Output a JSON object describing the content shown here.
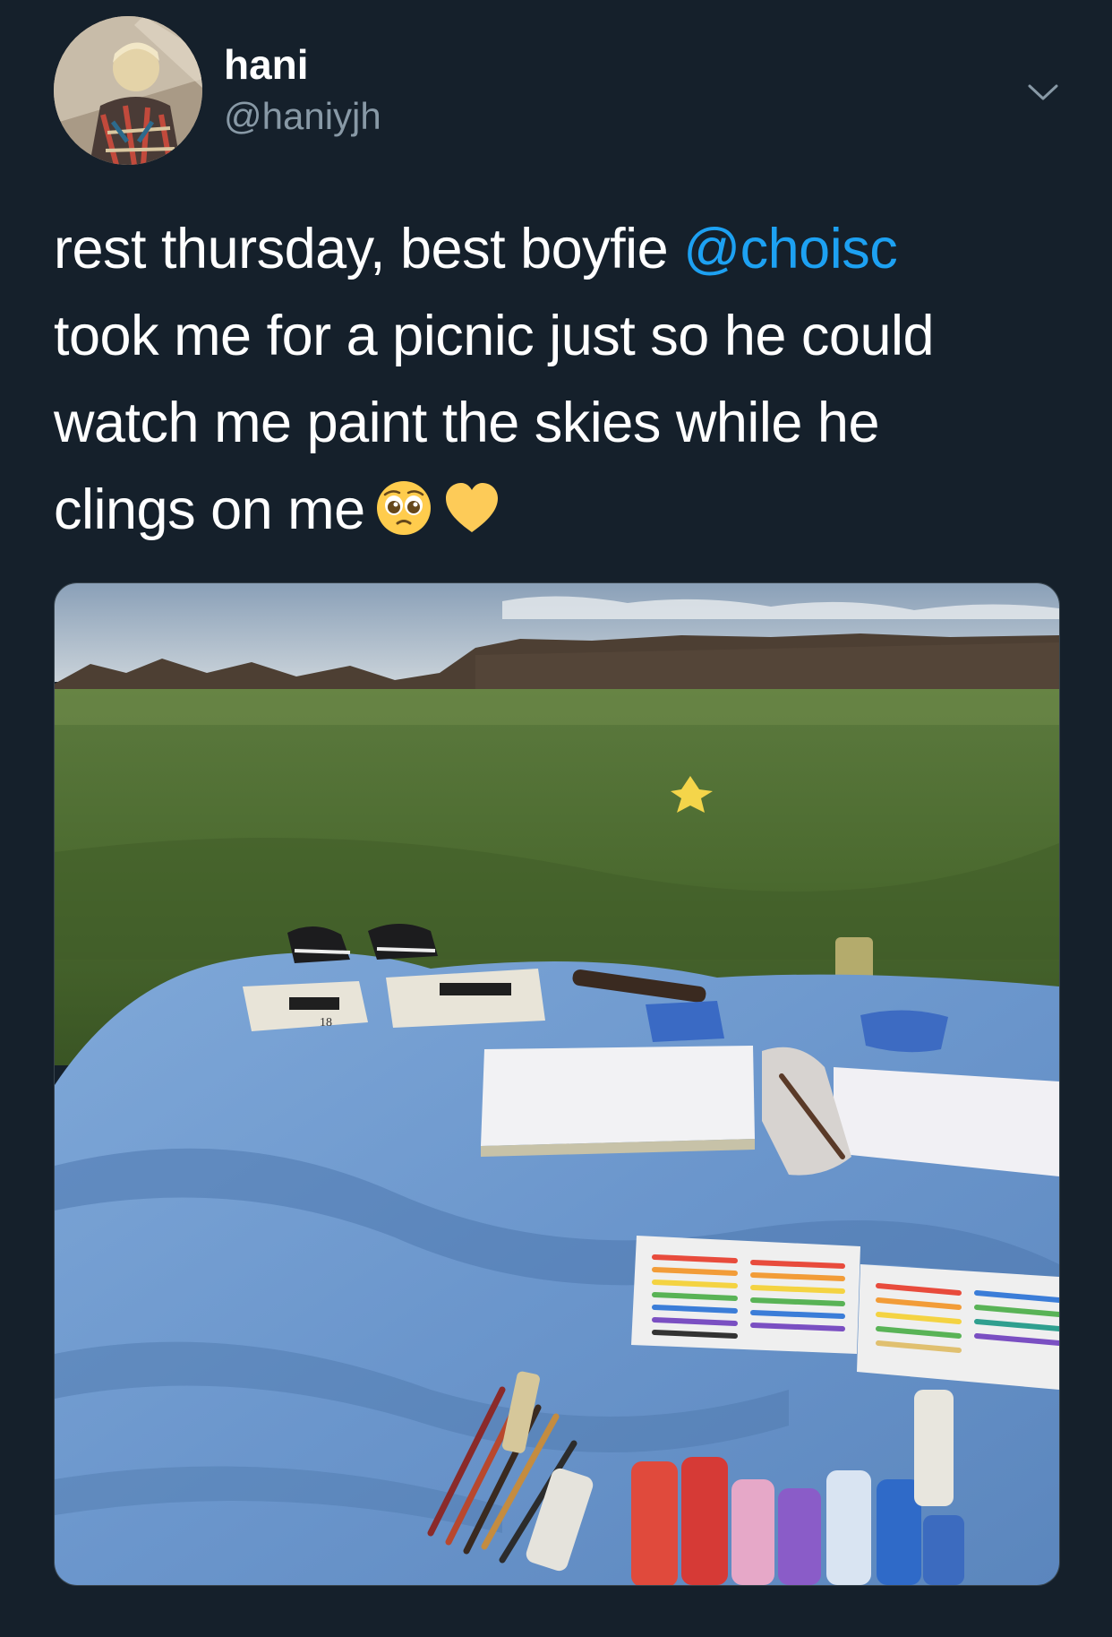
{
  "author": {
    "display_name": "hani",
    "handle": "@haniyjh"
  },
  "tweet": {
    "line1_text": "rest thursday, best boyfie ",
    "mention": "@choisc",
    "line2_text": "took me for a picnic just so he could",
    "line3_text": "watch me paint the skies while he",
    "line4_text": "clings on me",
    "emojis": [
      "pleading-face-emoji",
      "yellow-heart-emoji"
    ]
  },
  "media": {
    "kind": "photo",
    "paint_box_label": "18"
  },
  "colors": {
    "background": "#15202b",
    "text": "#ffffff",
    "secondary_text": "#8899a6",
    "link": "#1da1f2"
  }
}
